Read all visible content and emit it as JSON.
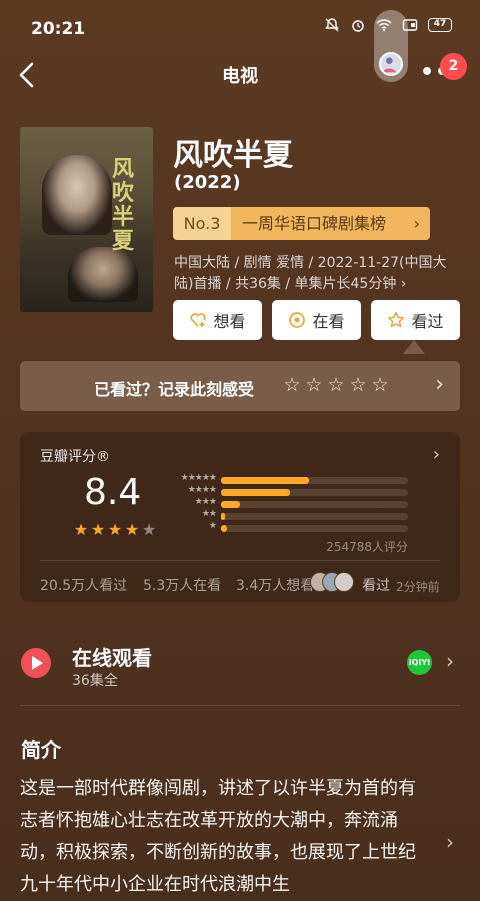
{
  "status_bar": {
    "time": "20:21",
    "battery": "47"
  },
  "nav": {
    "title": "电视",
    "more_label": "••",
    "badge": "2"
  },
  "show": {
    "title": "风吹半夏",
    "year": "(2022)",
    "poster_title": "风吹半夏",
    "rank_number": "No.3",
    "rank_label": "一周华语口碑剧集榜",
    "meta": "中国大陆 / 剧情 爱情 / 2022-11-27(中国大陆)首播 / 共36集 / 单集片长45分钟 ›"
  },
  "actions": [
    {
      "label": "想看",
      "icon": "heart-plus-icon"
    },
    {
      "label": "在看",
      "icon": "watching-circle-icon"
    },
    {
      "label": "看过",
      "icon": "star-outline-icon"
    }
  ],
  "record": {
    "text": "已看过？记录此刻感受",
    "stars": 5
  },
  "rating": {
    "label": "豆瓣评分®",
    "score": "8.4",
    "stars_filled": 4,
    "stars_total": 5,
    "distribution": [
      {
        "stars": "★★★★★",
        "fraction": 0.47
      },
      {
        "stars": "★★★★",
        "fraction": 0.37
      },
      {
        "stars": "★★★",
        "fraction": 0.1
      },
      {
        "stars": "★★",
        "fraction": 0.02
      },
      {
        "stars": "★",
        "fraction": 0.03
      }
    ],
    "count": "254788人评分",
    "stat_seen": "20.5万人看过",
    "stat_watching": "5.3万人在看",
    "stat_want": "3.4万人想看",
    "friends_seen": "看过",
    "friends_time": "2分钟前"
  },
  "online": {
    "title": "在线观看",
    "subtitle": "36集全",
    "platform": "iQIYI"
  },
  "synopsis": {
    "title": "简介",
    "body": "这是一部时代群像闯剧，讲述了以许半夏为首的有志者怀抱雄心壮志在改革开放的大潮中，奔流涌动，积极探索，不断创新的故事，也展现了上世纪九十年代中小企业在时代浪潮中生"
  },
  "colors": {
    "accent_orange": "#ffa726",
    "rank_gold": "#f1b65b",
    "play_red": "#f0505a",
    "iqiyi_green": "#1fc63b"
  }
}
